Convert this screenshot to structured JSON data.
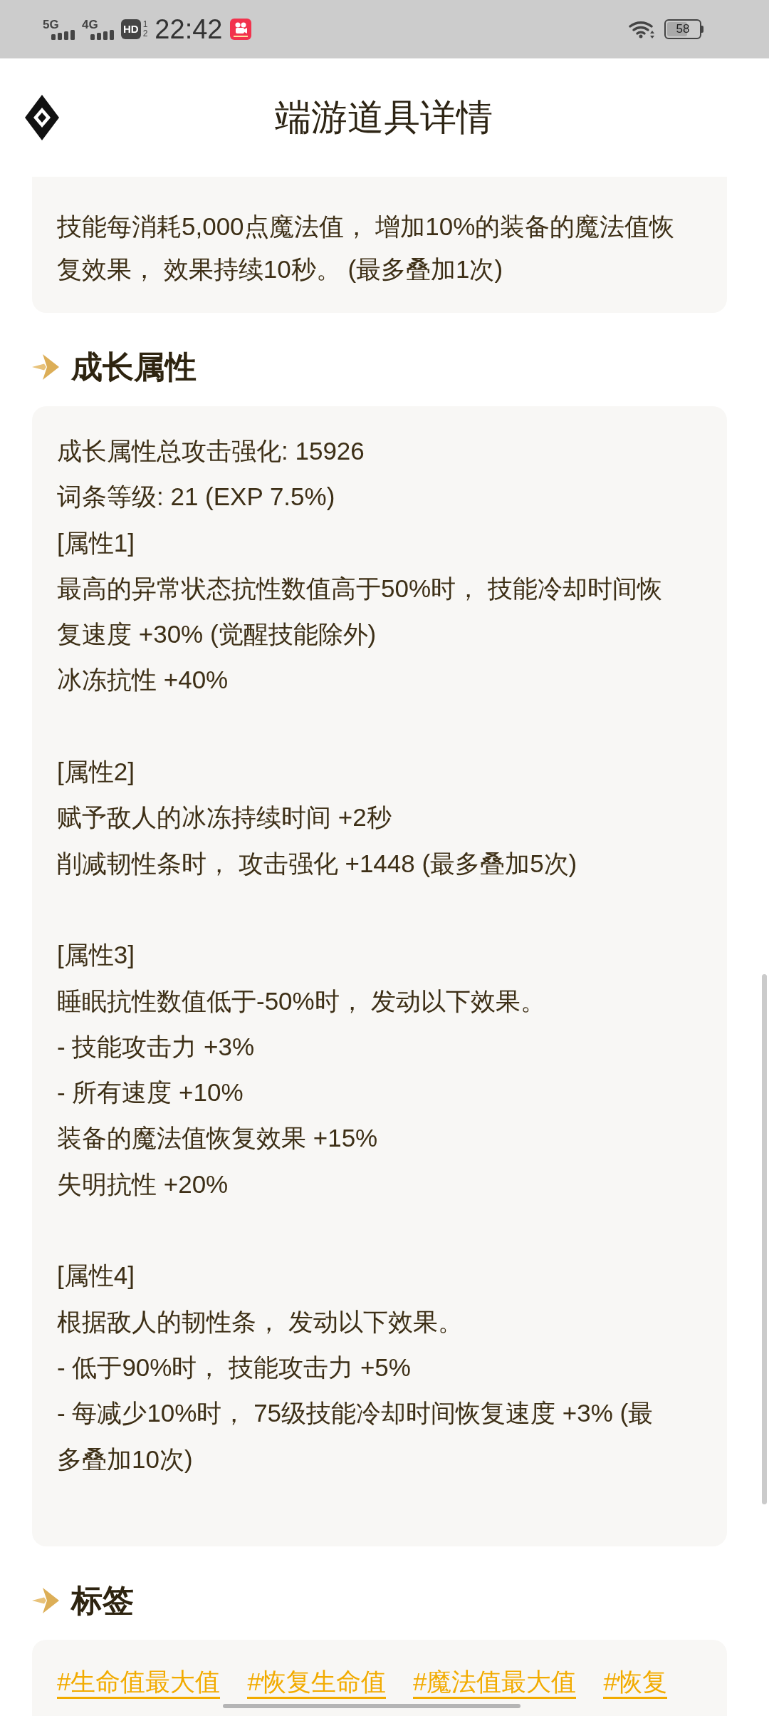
{
  "status_bar": {
    "networks": [
      {
        "label": "5G"
      },
      {
        "label": "4G"
      }
    ],
    "hd_badge": {
      "label": "HD",
      "sims": [
        "1",
        "2"
      ]
    },
    "time": "22:42",
    "battery": "58"
  },
  "header": {
    "title": "端游道具详情"
  },
  "description_card": {
    "text": "技能每消耗5,000点魔法值， 增加10%的装备的魔法值恢复效果， 效果持续10秒。 (最多叠加1次)"
  },
  "sections": [
    {
      "kind": "attributes",
      "title": "成长属性",
      "summary": [
        "成长属性总攻击强化: 15926",
        "词条等级: 21 (EXP 7.5%)"
      ],
      "groups": [
        {
          "label": "[属性1]",
          "lines": [
            "最高的异常状态抗性数值高于50%时， 技能冷却时间恢复速度 +30% (觉醒技能除外)",
            "冰冻抗性 +40%"
          ]
        },
        {
          "label": "[属性2]",
          "lines": [
            "赋予敌人的冰冻持续时间 +2秒",
            "削减韧性条时， 攻击强化 +1448 (最多叠加5次)"
          ]
        },
        {
          "label": "[属性3]",
          "lines": [
            "睡眠抗性数值低于-50%时， 发动以下效果。",
            "- 技能攻击力 +3%",
            "- 所有速度 +10%",
            "装备的魔法值恢复效果 +15%",
            "失明抗性 +20%"
          ]
        },
        {
          "label": "[属性4]",
          "lines": [
            "根据敌人的韧性条， 发动以下效果。",
            "- 低于90%时， 技能攻击力 +5%",
            "- 每减少10%时， 75级技能冷却时间恢复速度 +3% (最多叠加10次)"
          ]
        }
      ]
    },
    {
      "kind": "tags",
      "title": "标签",
      "tags": [
        "#生命值最大值",
        "#恢复生命值",
        "#魔法值最大值",
        "#恢复"
      ]
    }
  ]
}
